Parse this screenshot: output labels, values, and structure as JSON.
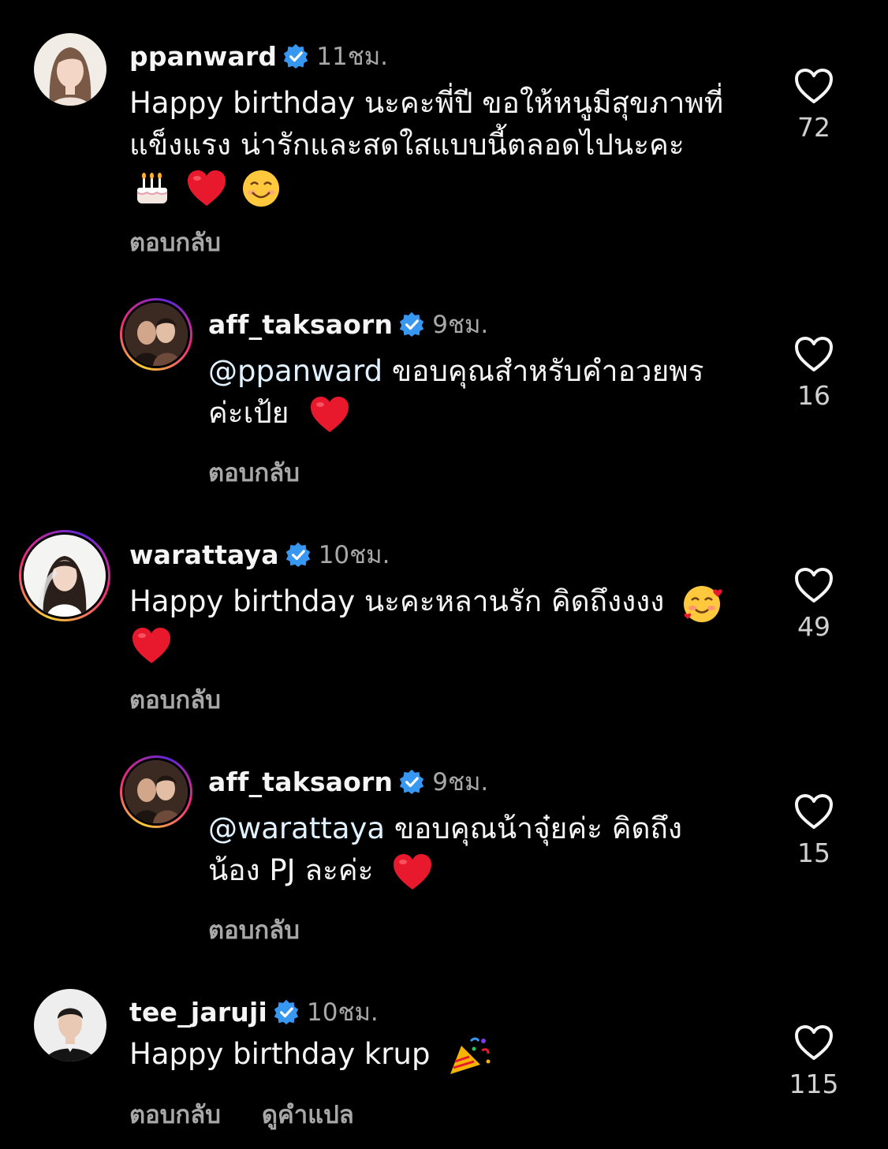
{
  "comments": [
    {
      "username": "ppanward",
      "time": "11ชม.",
      "lines": [
        "Happy birthday นะคะพี่ปี ขอให้หนูมีสุขภาพที่",
        "แข็งแรง น่ารักและสดใสแบบนี้ตลอดไปนะคะ"
      ],
      "emojis": [
        "birthday-cake",
        "red-heart",
        "smiling-face"
      ],
      "reply": "ตอบกลับ",
      "likes": "72"
    },
    {
      "username": "aff_taksaorn",
      "time": "9ชม.",
      "mention": "@ppanward",
      "lines": [
        " ขอบคุณสำหรับคำอวยพร",
        "ค่ะเป้ย"
      ],
      "emojis": [
        "red-heart"
      ],
      "reply": "ตอบกลับ",
      "likes": "16"
    },
    {
      "username": "warattaya",
      "time": "10ชม.",
      "lines": [
        "Happy birthday นะคะหลานรัก คิดถึงงงง"
      ],
      "emojis": [
        "smiling-face-with-hearts",
        "red-heart"
      ],
      "reply": "ตอบกลับ",
      "likes": "49"
    },
    {
      "username": "aff_taksaorn",
      "time": "9ชม.",
      "mention": "@warattaya",
      "lines": [
        " ขอบคุณน้าจุ๋ยค่ะ คิดถึง",
        "น้อง PJ ละค่ะ"
      ],
      "emojis": [
        "red-heart"
      ],
      "reply": "ตอบกลับ",
      "likes": "15"
    },
    {
      "username": "tee_jaruji",
      "time": "10ชม.",
      "lines": [
        "Happy birthday krup"
      ],
      "emojis": [
        "party-popper"
      ],
      "reply": "ตอบกลับ",
      "translate": "ดูคำแปล",
      "likes": "115"
    }
  ],
  "colors": {
    "background": "#000000",
    "text": "#f5f5f5",
    "secondary": "#a8a8a8",
    "verified": "#3897f0",
    "heart": "#e8192c"
  }
}
